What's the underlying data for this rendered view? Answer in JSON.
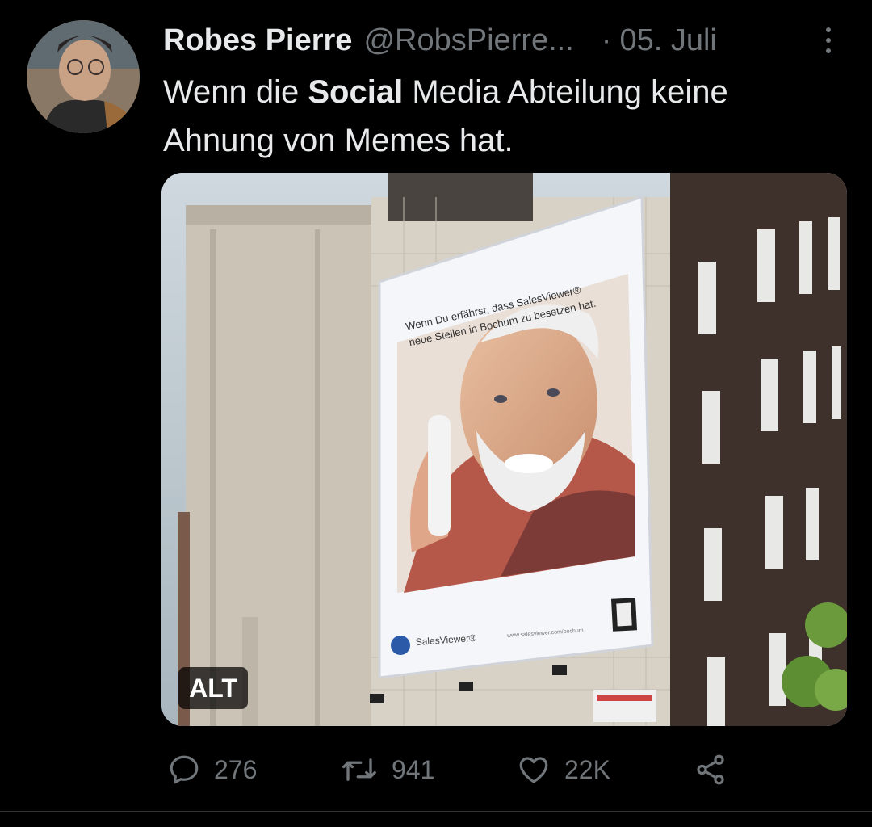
{
  "tweet": {
    "author_name": "Robes Pierre",
    "handle": "@RobsPierre...",
    "separator": "·",
    "date": "05. Juli",
    "text_part1": "Wenn die ",
    "text_bold": "Social",
    "text_part2": " Media Abteilung keine Ahnung von Memes hat."
  },
  "media": {
    "alt_badge": "ALT",
    "billboard_caption_line1": "Wenn Du erfährst, dass SalesViewer®",
    "billboard_caption_line2": "neue Stellen in Bochum zu besetzen hat.",
    "billboard_brand": "SalesViewer®",
    "billboard_url": "www.salesviewer.com/bochum"
  },
  "actions": {
    "reply_count": "276",
    "retweet_count": "941",
    "like_count": "22K"
  },
  "icons": {
    "more": "more-vertical-icon",
    "reply": "reply-icon",
    "retweet": "retweet-icon",
    "like": "heart-icon",
    "share": "share-icon"
  },
  "colors": {
    "background": "#000000",
    "text": "#e7e9ea",
    "muted": "#71767b"
  }
}
